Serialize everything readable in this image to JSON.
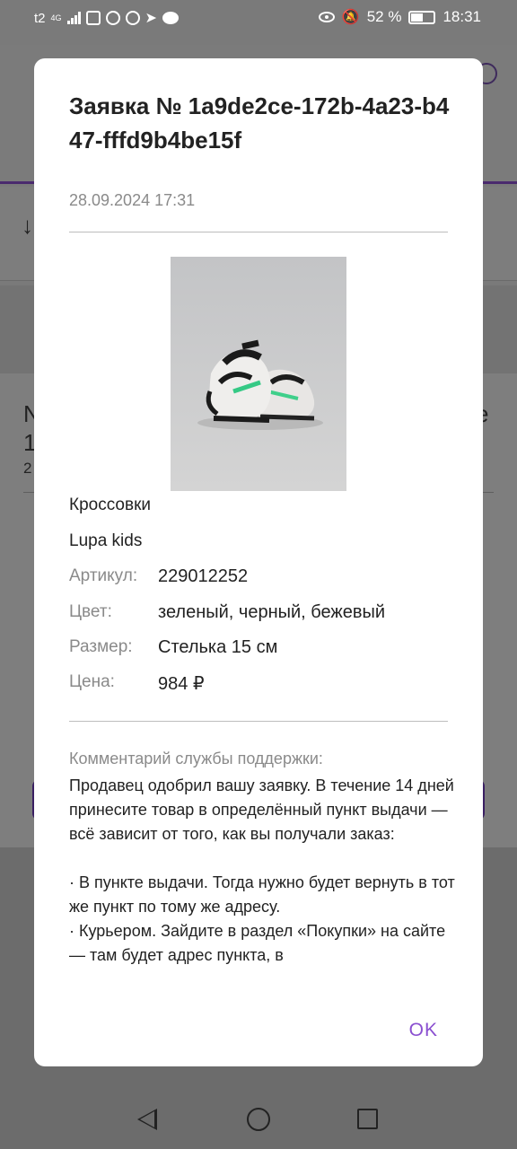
{
  "status_bar": {
    "carrier": "t2",
    "network": "4G",
    "battery": "52 %",
    "time": "18:31",
    "icons": [
      "signal-icon",
      "shield-icon",
      "whatsapp-icon",
      "telegram-icon",
      "telegram-send-icon",
      "chat-bubble-icon",
      "eye-icon",
      "bell-off-icon",
      "battery-icon"
    ]
  },
  "background": {
    "row_fragment_left": "N",
    "row_fragment_left2": "1",
    "row_fragment_left3": "2",
    "row_fragment_right": "e",
    "arrow_glyph": "↓"
  },
  "dialog": {
    "title": "Заявка № 1a9de2ce-172b-4a23-b447-fffd9b4be15f",
    "date": "28.09.2024 17:31",
    "product_type": "Кроссовки",
    "brand": "Lupa kids",
    "specs": [
      {
        "label": "Артикул:",
        "value": "229012252"
      },
      {
        "label": "Цвет:",
        "value": "зеленый, черный, бежевый"
      },
      {
        "label": "Размер:",
        "value": "Стелька 15 см"
      },
      {
        "label": "Цена:",
        "value": "984 ₽"
      }
    ],
    "comment_label": "Комментарий службы поддержки:",
    "comment_text": "Продавец одобрил вашу заявку. В течение 14 дней принесите товар в определённый пункт выдачи — всё зависит от того, как вы получали заказ:\n\n· В пункте выдачи. Тогда нужно будет вернуть в тот же пункт по тому же адресу.\n· Курьером. Зайдите в раздел «Покупки» на сайте — там будет адрес пункта, в",
    "ok_label": "OK"
  }
}
